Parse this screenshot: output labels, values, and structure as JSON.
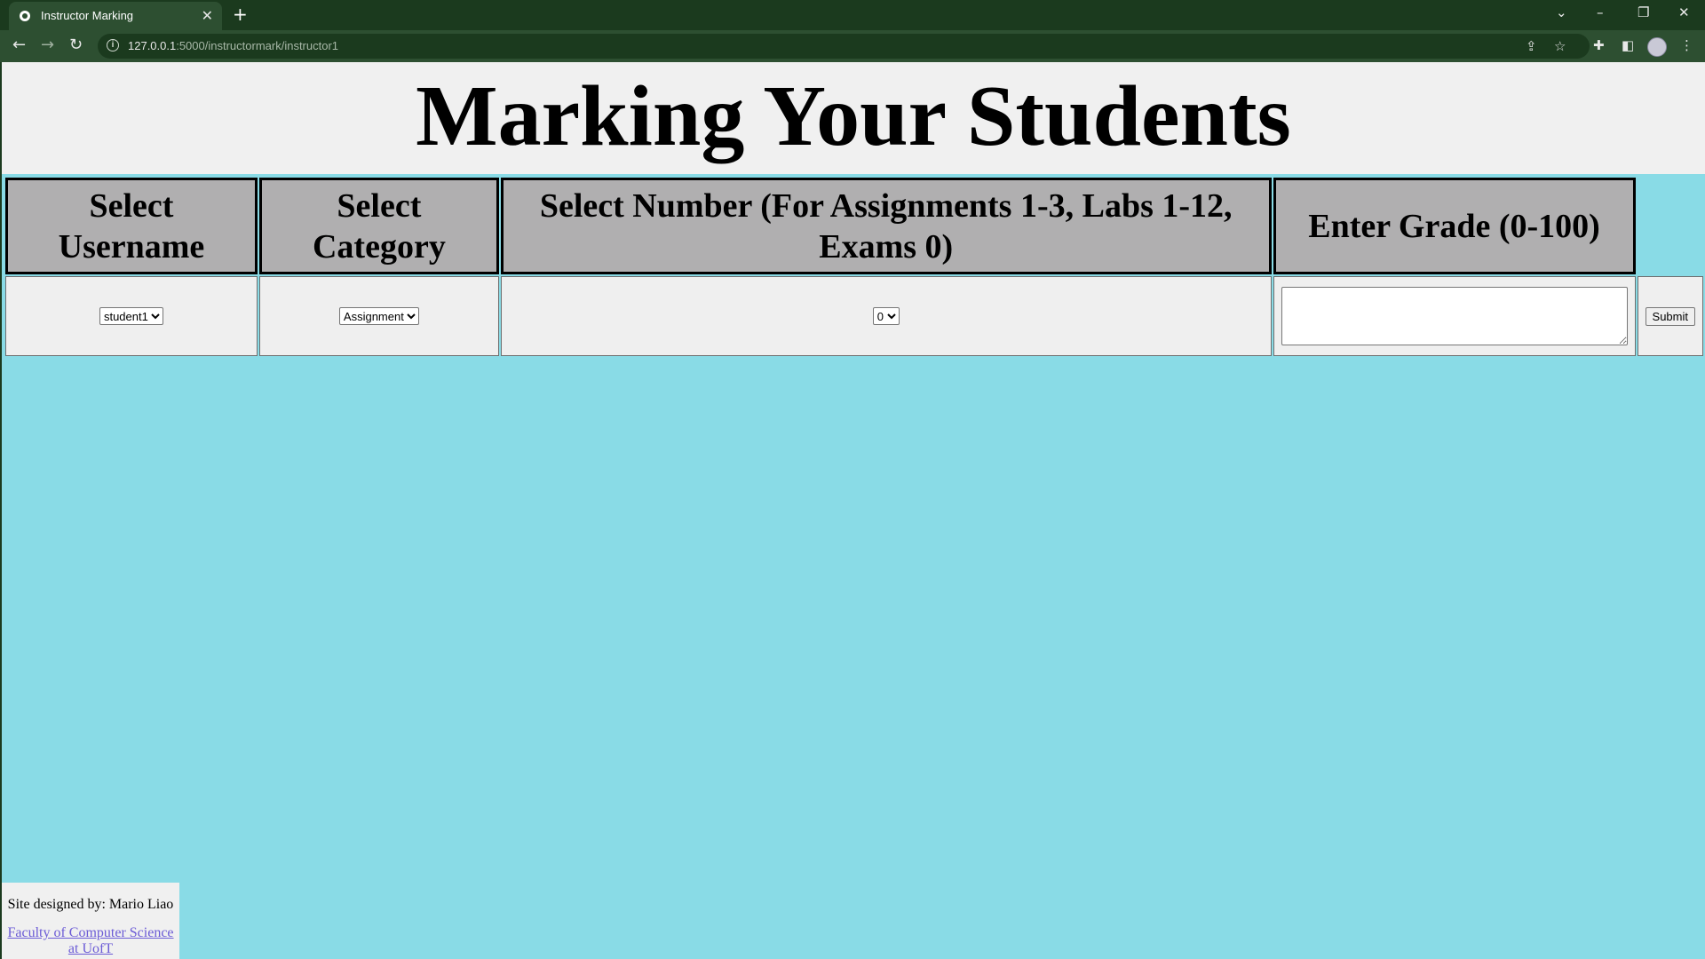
{
  "browser": {
    "tab_title": "Instructor Marking",
    "tab_close": "✕",
    "new_tab": "+",
    "url_host": "127.0.0.1",
    "url_path": ":5000/instructormark/instructor1"
  },
  "page": {
    "title": "Marking Your Students",
    "columns": [
      "Select Username",
      "Select Category",
      "Select Number (For Assignments 1-3, Labs 1-12, Exams 0)",
      "Enter Grade (0-100)"
    ],
    "username_select": {
      "selected": "student1"
    },
    "category_select": {
      "selected": "Assignment"
    },
    "number_select": {
      "selected": "0"
    },
    "grade_input": {
      "value": ""
    },
    "submit_label": "Submit"
  },
  "footer": {
    "credit": "Site designed by: Mario Liao",
    "link_text": "Faculty of Computer Science at UofT"
  }
}
